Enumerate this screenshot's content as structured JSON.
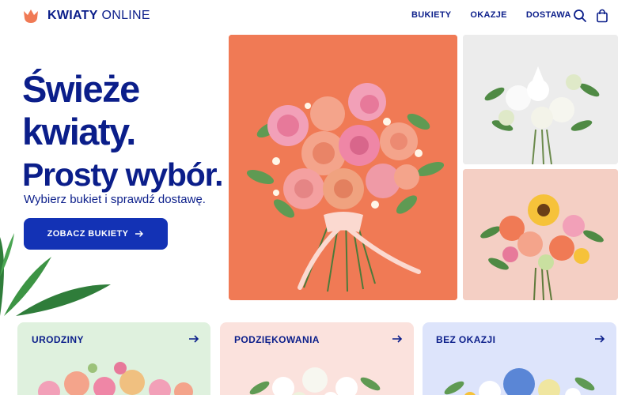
{
  "brand": {
    "name_bold": "KWIATY",
    "name_light": "ONLINE"
  },
  "nav": [
    "BUKIETY",
    "OKAZJE",
    "DOSTAWA"
  ],
  "header_icons": [
    "search-icon",
    "shopping-bag-icon"
  ],
  "hero": {
    "title_lines": [
      "Świeże",
      "kwiaty.",
      "Prosty wybór."
    ],
    "subtitle": "Wybierz bukiet i sprawdź dostawę.",
    "cta_label": "ZOBACZ BUKIETY"
  },
  "categories": [
    {
      "label": "URODZINY",
      "color": "#dff1de"
    },
    {
      "label": "PODZIĘKOWANIA",
      "color": "#fbe2dd"
    },
    {
      "label": "BEZ OKAZJI",
      "color": "#dde4fb"
    }
  ],
  "colors": {
    "brand_blue": "#0b1e8a",
    "button_blue": "#1332b5",
    "accent_orange": "#f07a55"
  }
}
